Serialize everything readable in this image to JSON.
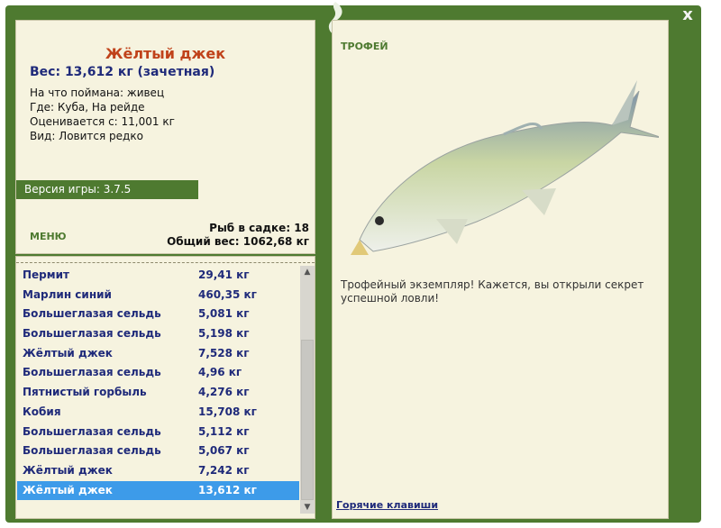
{
  "header": {
    "close_label": "x"
  },
  "catch": {
    "title": "Жёлтый джек",
    "weight": "Вес: 13,612 кг (зачетная)",
    "bait": "На что поймана: живец",
    "place": "Где: Куба, На рейде",
    "value": "Оценивается с: 11,001 кг",
    "kind": "Вид: Ловится редко"
  },
  "version": "Версия игры: 3.7.5",
  "menu_label": "МЕНЮ",
  "stats": {
    "count": "Рыб в садке: 18",
    "total": "Общий вес: 1062,68 кг"
  },
  "list": [
    {
      "name": "Пермит",
      "weight": "29,41 кг"
    },
    {
      "name": "Марлин синий",
      "weight": "460,35 кг"
    },
    {
      "name": "Большеглазая сельдь",
      "weight": "5,081 кг"
    },
    {
      "name": "Большеглазая сельдь",
      "weight": "5,198 кг"
    },
    {
      "name": "Жёлтый джек",
      "weight": "7,528 кг"
    },
    {
      "name": "Большеглазая сельдь",
      "weight": "4,96 кг"
    },
    {
      "name": "Пятнистый горбыль",
      "weight": "4,276 кг"
    },
    {
      "name": "Кобия",
      "weight": "15,708 кг"
    },
    {
      "name": "Большеглазая сельдь",
      "weight": "5,112 кг"
    },
    {
      "name": "Большеглазая сельдь",
      "weight": "5,067 кг"
    },
    {
      "name": "Жёлтый джек",
      "weight": "7,242 кг"
    },
    {
      "name": "Жёлтый джек",
      "weight": "13,612 кг"
    }
  ],
  "selected_index": 11,
  "trophy": {
    "label": "ТРОФЕЙ",
    "description": "Трофейный экземпляр! Кажется, вы открыли секрет успешной ловли!"
  },
  "hotkeys_label": "Горячие клавиши",
  "colors": {
    "frame_green": "#4e7a30",
    "panel": "#f6f3df",
    "title": "#c0421a",
    "text_blue": "#1f2a7a",
    "selection": "#3d9be9"
  }
}
